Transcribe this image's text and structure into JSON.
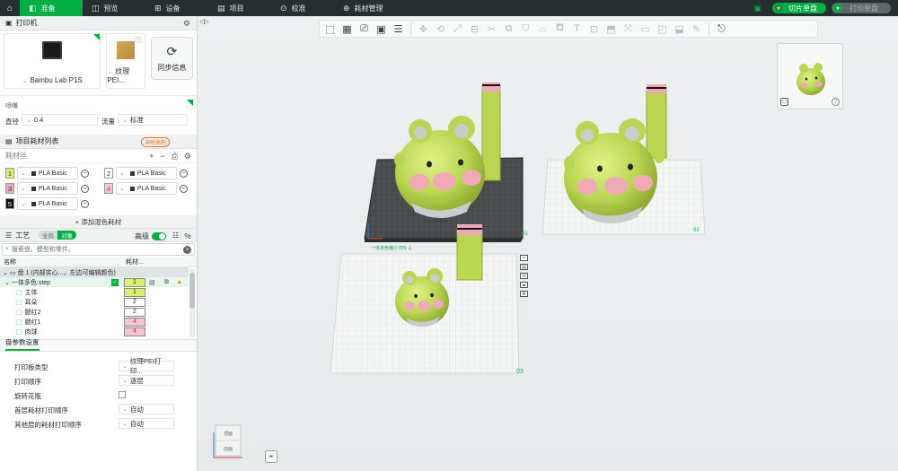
{
  "topbar": {
    "tabs": [
      {
        "label": "准备",
        "icon": "prepare-icon"
      },
      {
        "label": "预览",
        "icon": "preview-icon"
      },
      {
        "label": "设备",
        "icon": "device-icon"
      },
      {
        "label": "项目",
        "icon": "project-icon"
      },
      {
        "label": "校准",
        "icon": "calibrate-icon"
      },
      {
        "label": "耗材管理",
        "icon": "filament-manage-icon"
      }
    ],
    "slice_label": "切片单盘",
    "print_label": "打印单盘"
  },
  "printer": {
    "section_title": "打印机",
    "printer_name": "Bambu Lab P1S",
    "plate_name": "纹理PEI...",
    "sync_label": "同步信息",
    "nozzle_label": "喷嘴",
    "diameter_label": "直径",
    "diameter_value": "0.4",
    "flow_label": "流量",
    "flow_value": "标准"
  },
  "filaments": {
    "section_title": "项目耗材列表",
    "badge": "冲刷体积",
    "sub_label": "耗材丝",
    "items": [
      {
        "num": "1",
        "name": "PLA Basic",
        "color": "#d6f36b",
        "text_color": "#262e30"
      },
      {
        "num": "2",
        "name": "PLA Basic",
        "color": "#ffffff",
        "text_color": "#262e30"
      },
      {
        "num": "3",
        "name": "PLA Basic",
        "color": "#f2a7b8",
        "text_color": "#262e30"
      },
      {
        "num": "4",
        "name": "PLA Basic",
        "color": "#f6c6d0",
        "text_color": "#d3305a"
      },
      {
        "num": "5",
        "name": "PLA Basic",
        "color": "#111111",
        "text_color": "#ffffff"
      }
    ],
    "add_mix_label": "+ 添加混色耗材"
  },
  "process": {
    "section_title": "工艺",
    "global_label": "全局",
    "object_label": "对象",
    "advanced_label": "高级",
    "search_placeholder": "搜索盘、模型和零件。",
    "col_name": "名称",
    "col_filament": "耗材...",
    "rows": [
      {
        "name": "盘 1 (内部实心...，左边可编辑颜色)",
        "value": ""
      },
      {
        "name": "一体多色.step",
        "value": "1"
      },
      {
        "name": "主体",
        "value": "1"
      },
      {
        "name": "耳朵",
        "value": "2"
      },
      {
        "name": "腮红2",
        "value": "2"
      },
      {
        "name": "腮红1",
        "value": "4"
      },
      {
        "name": "肉球",
        "value": "4"
      }
    ]
  },
  "plate_settings": {
    "tab_label": "盘参数设置",
    "rows": [
      {
        "label": "打印板类型",
        "value": "纹理PEI打印..."
      },
      {
        "label": "打印顺序",
        "value": "逐层"
      },
      {
        "label": "旋转花瓶",
        "value": ""
      },
      {
        "label": "首层耗材打印顺序",
        "value": "自动"
      },
      {
        "label": "其他层的耗材打印顺序",
        "value": "自动"
      }
    ]
  },
  "viewport": {
    "plate_labels": [
      "01",
      "02",
      "03"
    ],
    "warning_text": "一体多色缩小70% ∠",
    "view_cube_front": "前面",
    "view_cube_top": "顶面"
  },
  "colors": {
    "accent": "#00ae42",
    "topbar": "#262e30",
    "model_green": "#b8d650",
    "model_pink": "#f2a7b8"
  }
}
